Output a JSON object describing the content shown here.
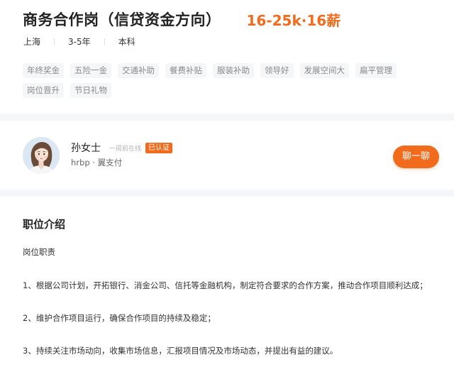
{
  "job": {
    "title": "商务合作岗（信贷资金方向）",
    "salary": "16-25k·16薪",
    "meta": {
      "location": "上海",
      "experience": "3-5年",
      "education": "本科"
    },
    "tags": [
      "年终奖金",
      "五险一金",
      "交通补助",
      "餐费补贴",
      "服装补助",
      "领导好",
      "发展空间大",
      "扁平管理",
      "岗位晋升",
      "节日礼物"
    ]
  },
  "recruiter": {
    "name": "孙女士",
    "online_status": "一周前在线",
    "badge": "已认证",
    "subtitle": "hrbp · 翼支付",
    "chat_button_label": "聊一聊",
    "avatar_icon": "woman-avatar-icon"
  },
  "description": {
    "title": "职位介绍",
    "section_heading": "岗位职责",
    "lines": [
      "1、根据公司计划，开拓银行、消金公司、信托等金融机构，制定符合要求的合作方案，推动合作项目顺利达成；",
      "2、维护合作项目运行，确保合作项目的持续及稳定；",
      "3、持续关注市场动向，收集市场信息，汇报项目情况及市场动态，并提出有益的建议。"
    ]
  },
  "colors": {
    "accent": "#f26b1d",
    "tag_background": "#f5f6f8",
    "tag_text": "#8a8a8a",
    "band": "#f5f6f8"
  }
}
